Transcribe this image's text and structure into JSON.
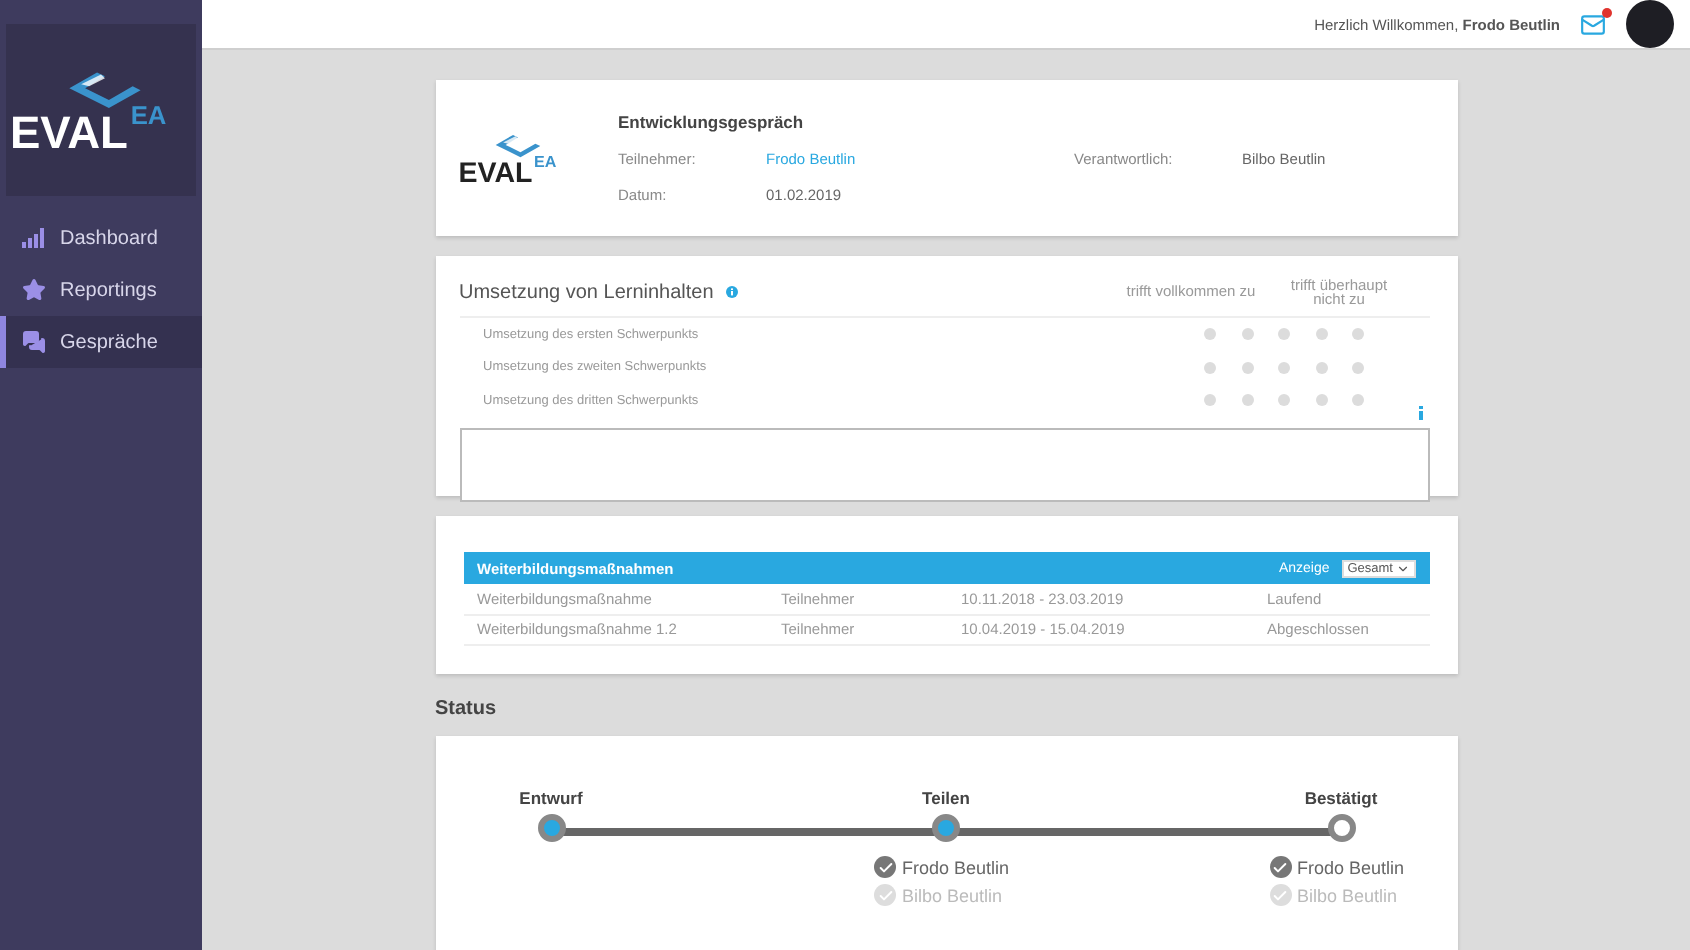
{
  "sidebar": {
    "logo": {
      "main": "EVAL",
      "sup": "EA"
    },
    "items": [
      {
        "label": "Dashboard",
        "kind": "bars",
        "selected": false
      },
      {
        "label": "Reportings",
        "kind": "star",
        "selected": false
      },
      {
        "label": "Gespräche",
        "kind": "chat",
        "selected": true
      }
    ]
  },
  "header": {
    "greeting": "Herzlich Willkommen,",
    "user": "Frodo Beutlin",
    "unread": true
  },
  "interview": {
    "logo": {
      "main": "EVAL",
      "sup": "EA"
    },
    "title": "Entwicklungsgespräch",
    "participant_label": "Teilnehmer:",
    "participant": "Frodo Beutlin",
    "responsible_label": "Verantwortlich:",
    "responsible": "Bilbo Beutlin",
    "date_label": "Datum:",
    "date": "01.02.2019"
  },
  "rating": {
    "title": "Umsetzung von Lerninhalten",
    "scale_left": "trifft vollkommen zu",
    "scale_right": "trifft überhaupt nicht zu",
    "items": [
      {
        "label": "Umsetzung des ersten Schwerpunkts",
        "options": [
          {
            "selected": false
          },
          {
            "selected": false
          },
          {
            "selected": false
          },
          {
            "selected": false
          },
          {
            "selected": false
          }
        ]
      },
      {
        "label": "Umsetzung des zweiten Schwerpunkts",
        "options": [
          {
            "selected": false
          },
          {
            "selected": false
          },
          {
            "selected": false
          },
          {
            "selected": false
          },
          {
            "selected": false
          }
        ]
      },
      {
        "label": "Umsetzung des dritten Schwerpunkts",
        "options": [
          {
            "selected": false
          },
          {
            "selected": false
          },
          {
            "selected": false
          },
          {
            "selected": false
          },
          {
            "selected": false
          }
        ]
      }
    ]
  },
  "trainings": {
    "title": "Weiterbildungsmaßnahmen",
    "filter_label": "Anzeige",
    "filter_value": "Gesamt",
    "rows": [
      {
        "name": "Weiterbildungsmaßnahme",
        "role": "Teilnehmer",
        "period": "10.11.2018 - 23.03.2019",
        "status": "Laufend"
      },
      {
        "name": "Weiterbildungsmaßnahme 1.2",
        "role": "Teilnehmer",
        "period": "10.04.2019 - 15.04.2019",
        "status": "Abgeschlossen"
      }
    ]
  },
  "status": {
    "title": "Status",
    "steps": [
      {
        "label": "Entwurf",
        "done": true
      },
      {
        "label": "Teilen",
        "done": true,
        "approvals": [
          {
            "name": "Frodo Beutlin",
            "checked": true
          },
          {
            "name": "Bilbo Beutlin",
            "checked": false
          }
        ]
      },
      {
        "label": "Bestätigt",
        "done": false,
        "approvals": [
          {
            "name": "Frodo Beutlin",
            "checked": true
          },
          {
            "name": "Bilbo Beutlin",
            "checked": false
          }
        ]
      }
    ]
  }
}
